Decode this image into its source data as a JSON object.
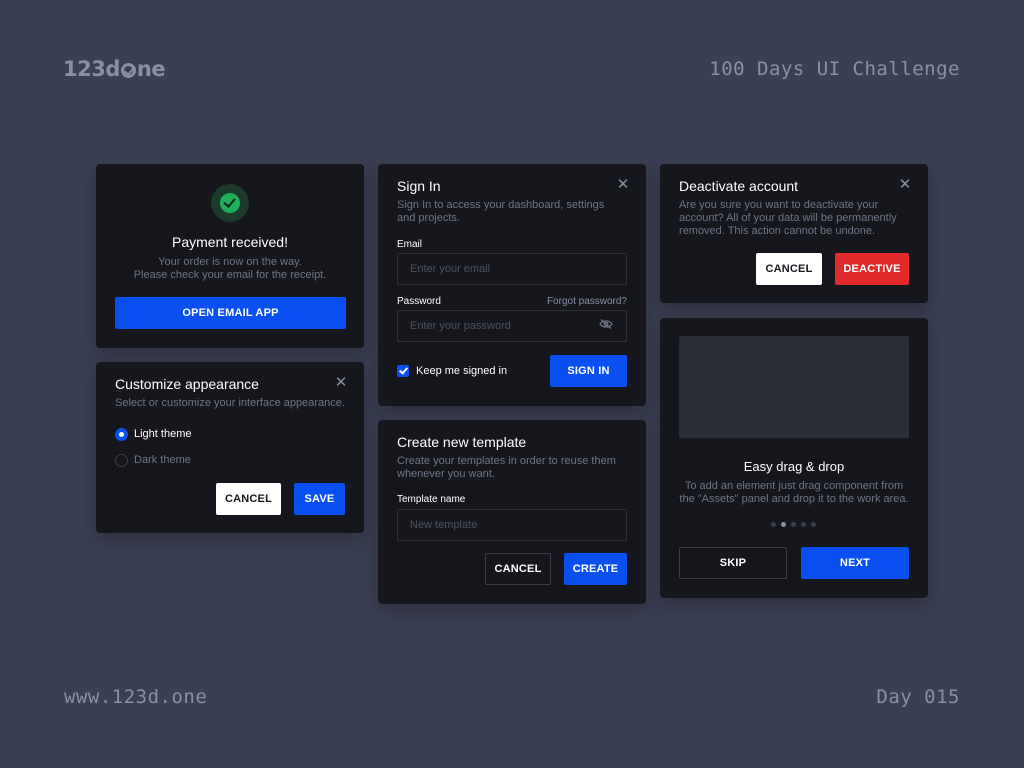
{
  "header": {
    "logo_left": "123d",
    "logo_right": "ne",
    "challenge_title": "100 Days UI Challenge"
  },
  "footer": {
    "url": "www.123d.one",
    "day": "Day 015"
  },
  "payment": {
    "title": "Payment received!",
    "line1": "Your order is now on the way.",
    "line2": "Please check your email for the receipt.",
    "button": "OPEN EMAIL APP"
  },
  "appearance": {
    "title": "Customize appearance",
    "subtitle": "Select or customize your interface appearance.",
    "options": [
      {
        "label": "Light theme",
        "selected": true
      },
      {
        "label": "Dark theme",
        "selected": false
      }
    ],
    "cancel": "CANCEL",
    "save": "SAVE"
  },
  "signin": {
    "title": "Sign In",
    "subtitle": "Sign In to access your dashboard, settings and projects.",
    "email_label": "Email",
    "email_placeholder": "Enter your email",
    "password_label": "Password",
    "forgot": "Forgot password?",
    "password_placeholder": "Enter your password",
    "keep_signed": "Keep me signed in",
    "button": "SIGN IN"
  },
  "template": {
    "title": "Create new template",
    "subtitle": "Create your templates in order to reuse them whenever you want.",
    "name_label": "Template name",
    "name_placeholder": "New template",
    "cancel": "CANCEL",
    "create": "CREATE"
  },
  "deactivate": {
    "title": "Deactivate account",
    "subtitle": "Are you sure you want to deactivate your account? All of your data will be permanently removed. This action cannot be undone.",
    "cancel": "CANCEL",
    "confirm": "DEACTIVE"
  },
  "onboarding": {
    "title": "Easy drag & drop",
    "subtitle": "To add an element just drag component from the \"Assets\" panel and drop it to the work area.",
    "skip": "SKIP",
    "next": "NEXT",
    "active_step": 2,
    "total_steps": 5
  },
  "colors": {
    "background": "#3b3f54",
    "card": "#16171d",
    "primary": "#0a4ff0",
    "danger": "#e32a2a",
    "success": "#1fae5a"
  }
}
